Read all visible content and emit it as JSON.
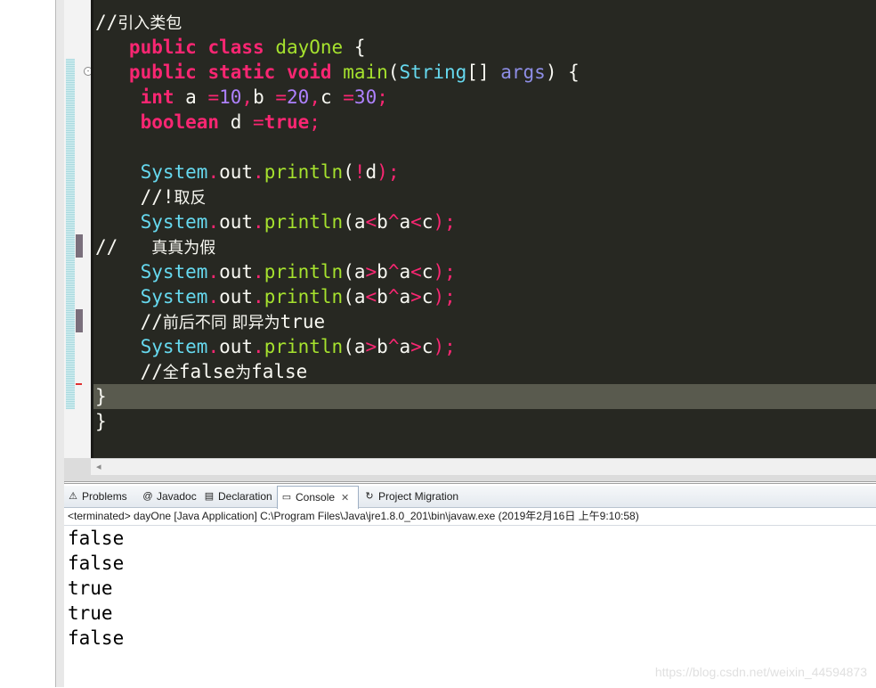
{
  "editor": {
    "lines": [
      {
        "segments": [
          {
            "t": "//",
            "c": "cm"
          },
          {
            "t": "引入类包",
            "c": "cm cjk"
          }
        ]
      },
      {
        "segments": [
          {
            "t": "   public",
            "c": "kw"
          },
          {
            "t": " ",
            "c": ""
          },
          {
            "t": "class",
            "c": "kw"
          },
          {
            "t": " ",
            "c": ""
          },
          {
            "t": "dayOne",
            "c": "cls"
          },
          {
            "t": " {",
            "c": ""
          }
        ]
      },
      {
        "segments": [
          {
            "t": "   public",
            "c": "kw"
          },
          {
            "t": " ",
            "c": ""
          },
          {
            "t": "static",
            "c": "kw"
          },
          {
            "t": " ",
            "c": ""
          },
          {
            "t": "void",
            "c": "kw"
          },
          {
            "t": " ",
            "c": ""
          },
          {
            "t": "main",
            "c": "fn"
          },
          {
            "t": "(",
            "c": ""
          },
          {
            "t": "String",
            "c": "ty"
          },
          {
            "t": "[] ",
            "c": ""
          },
          {
            "t": "args",
            "c": "prm"
          },
          {
            "t": ") {",
            "c": ""
          }
        ]
      },
      {
        "segments": [
          {
            "t": "    int",
            "c": "kw"
          },
          {
            "t": " a ",
            "c": ""
          },
          {
            "t": "=",
            "c": "op"
          },
          {
            "t": "10",
            "c": "num"
          },
          {
            "t": ",",
            "c": "op"
          },
          {
            "t": "b ",
            "c": ""
          },
          {
            "t": "=",
            "c": "op"
          },
          {
            "t": "20",
            "c": "num"
          },
          {
            "t": ",",
            "c": "op"
          },
          {
            "t": "c ",
            "c": ""
          },
          {
            "t": "=",
            "c": "op"
          },
          {
            "t": "30",
            "c": "num"
          },
          {
            "t": ";",
            "c": "op"
          }
        ]
      },
      {
        "segments": [
          {
            "t": "    boolean",
            "c": "kw"
          },
          {
            "t": " d ",
            "c": ""
          },
          {
            "t": "=",
            "c": "op"
          },
          {
            "t": "true",
            "c": "kw"
          },
          {
            "t": ";",
            "c": "op"
          }
        ]
      },
      {
        "segments": [
          {
            "t": "",
            "c": ""
          }
        ]
      },
      {
        "segments": [
          {
            "t": "    System",
            "c": "ty"
          },
          {
            "t": ".",
            "c": "op"
          },
          {
            "t": "out",
            "c": "cm"
          },
          {
            "t": ".",
            "c": "op"
          },
          {
            "t": "println",
            "c": "fn"
          },
          {
            "t": "(",
            "c": ""
          },
          {
            "t": "!",
            "c": "op"
          },
          {
            "t": "d",
            "c": ""
          },
          {
            "t": ");",
            "c": "op"
          }
        ]
      },
      {
        "segments": [
          {
            "t": "    //!",
            "c": "cm"
          },
          {
            "t": "取反",
            "c": "cm cjk"
          }
        ]
      },
      {
        "segments": [
          {
            "t": "    System",
            "c": "ty"
          },
          {
            "t": ".",
            "c": "op"
          },
          {
            "t": "out",
            "c": "cm"
          },
          {
            "t": ".",
            "c": "op"
          },
          {
            "t": "println",
            "c": "fn"
          },
          {
            "t": "(a",
            "c": ""
          },
          {
            "t": "<",
            "c": "op"
          },
          {
            "t": "b",
            "c": ""
          },
          {
            "t": "^",
            "c": "op"
          },
          {
            "t": "a",
            "c": ""
          },
          {
            "t": "<",
            "c": "op"
          },
          {
            "t": "c",
            ":c": ""
          },
          {
            "t": ");",
            "c": "op"
          }
        ]
      },
      {
        "segments": [
          {
            "t": "//   ",
            "c": "cm"
          },
          {
            "t": "真真为假",
            "c": "cm cjk"
          }
        ]
      },
      {
        "segments": [
          {
            "t": "    System",
            "c": "ty"
          },
          {
            "t": ".",
            "c": "op"
          },
          {
            "t": "out",
            "c": "cm"
          },
          {
            "t": ".",
            "c": "op"
          },
          {
            "t": "println",
            "c": "fn"
          },
          {
            "t": "(a",
            "c": ""
          },
          {
            "t": ">",
            "c": "op"
          },
          {
            "t": "b",
            "c": ""
          },
          {
            "t": "^",
            "c": "op"
          },
          {
            "t": "a",
            "c": ""
          },
          {
            "t": "<",
            "c": "op"
          },
          {
            "t": "c",
            "c": ""
          },
          {
            "t": ");",
            "c": "op"
          }
        ]
      },
      {
        "segments": [
          {
            "t": "    System",
            "c": "ty"
          },
          {
            "t": ".",
            "c": "op"
          },
          {
            "t": "out",
            "c": "cm"
          },
          {
            "t": ".",
            "c": "op"
          },
          {
            "t": "println",
            "c": "fn"
          },
          {
            "t": "(a",
            "c": ""
          },
          {
            "t": "<",
            "c": "op"
          },
          {
            "t": "b",
            "c": ""
          },
          {
            "t": "^",
            "c": "op"
          },
          {
            "t": "a",
            "c": ""
          },
          {
            "t": ">",
            "c": "op"
          },
          {
            "t": "c",
            "c": ""
          },
          {
            "t": ");",
            "c": "op"
          }
        ]
      },
      {
        "segments": [
          {
            "t": "    //",
            "c": "cm"
          },
          {
            "t": "前后不同 即异为",
            "c": "cm cjk"
          },
          {
            "t": "true",
            "c": "cm"
          }
        ]
      },
      {
        "segments": [
          {
            "t": "    System",
            "c": "ty"
          },
          {
            "t": ".",
            "c": "op"
          },
          {
            "t": "out",
            "c": "cm"
          },
          {
            "t": ".",
            "c": "op"
          },
          {
            "t": "println",
            "c": "fn"
          },
          {
            "t": "(a",
            "c": ""
          },
          {
            "t": ">",
            "c": "op"
          },
          {
            "t": "b",
            "c": ""
          },
          {
            "t": "^",
            "c": "op"
          },
          {
            "t": "a",
            "c": ""
          },
          {
            "t": ">",
            "c": "op"
          },
          {
            "t": "c",
            "c": ""
          },
          {
            "t": ");",
            "c": "op"
          }
        ]
      },
      {
        "segments": [
          {
            "t": "    //",
            "c": "cm"
          },
          {
            "t": "全",
            "c": "cm cjk"
          },
          {
            "t": "false",
            "c": "cm"
          },
          {
            "t": "为",
            "c": "cm cjk"
          },
          {
            "t": "false",
            "c": "cm"
          }
        ]
      },
      {
        "segments": [
          {
            "t": "}",
            "c": ""
          }
        ]
      },
      {
        "segments": [
          {
            "t": "}",
            "c": ""
          }
        ]
      }
    ]
  },
  "panel": {
    "tabs": [
      {
        "label": "Problems",
        "icon": "problems-icon",
        "glyph": "⚠",
        "active": false
      },
      {
        "label": "Javadoc",
        "icon": "javadoc-icon",
        "glyph": "@",
        "active": false
      },
      {
        "label": "Declaration",
        "icon": "declaration-icon",
        "glyph": "▤",
        "active": false
      },
      {
        "label": "Console",
        "icon": "console-icon",
        "glyph": "▭",
        "active": true
      },
      {
        "label": "Project Migration",
        "icon": "project-migration-icon",
        "glyph": "↻",
        "active": false
      }
    ],
    "status": "<terminated> dayOne [Java Application] C:\\Program Files\\Java\\jre1.8.0_201\\bin\\javaw.exe (2019年2月16日 上午9:10:58)",
    "output": [
      "false",
      "false",
      "true",
      "true",
      "false"
    ]
  },
  "watermark": "https://blog.csdn.net/weixin_44594873"
}
